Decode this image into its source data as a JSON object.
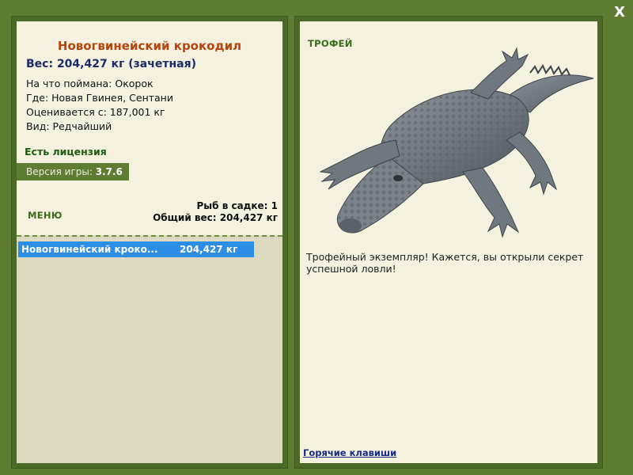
{
  "window": {
    "close_label": "X"
  },
  "fish": {
    "title": "Новогвинейский крокодил",
    "weight": "Вес: 204,427 кг (зачетная)",
    "details": [
      "На что поймана: Окорок",
      "Где: Новая Гвинея, Сентани",
      "Оценивается с: 187,001 кг",
      "Вид: Редчайший"
    ]
  },
  "license": {
    "label": "Есть лицензия"
  },
  "version": {
    "label": "Версия игры: ",
    "value": "3.7.6"
  },
  "menu": {
    "label": "МЕНЮ"
  },
  "stats": {
    "fish_in_net": "Рыб в садке: 1",
    "total_weight": "Общий вес: 204,427 кг"
  },
  "catch_list": [
    {
      "name": "Новогвинейский кроко...",
      "weight": "204,427 кг"
    }
  ],
  "trophy": {
    "label": "ТРОФЕЙ",
    "text": "Трофейный экземпляр! Кажется, вы открыли секрет успешной ловли!",
    "image": "crocodile-illustration"
  },
  "hotkeys": {
    "label": "Горячие клавиши"
  },
  "colors": {
    "frame": "#5e7d32",
    "panel_bg": "#f4f1de",
    "title": "#b5440f",
    "weight": "#1d2a6a",
    "license": "#1e5c12",
    "selection": "#2d8ee6",
    "link": "#1a2a8a"
  }
}
